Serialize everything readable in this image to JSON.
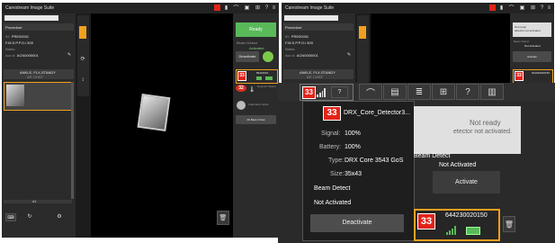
{
  "left": {
    "app_title": "Carestream Image Suite",
    "tab_label": "Procedure",
    "info_rows": [
      {
        "label": "ID:",
        "value": "PRE00001"
      },
      {
        "label": "",
        "value": "F.M.S.P.P.O.I 500"
      },
      {
        "label": "Notes",
        "value": ""
      },
      {
        "label": "Acc #:",
        "value": "ACN0000001"
      }
    ],
    "view_label": "ANKLE, FLX-STANDY",
    "view_sub": "AP, CHST",
    "ready_label": "Ready",
    "beam_detect": "Beam Detect",
    "beam_status": "Activated",
    "deactivate_label": "Deactivate",
    "detector_id": "89110510",
    "collapse_label": "Detector Status",
    "status_text": "Calibration Mode",
    "recon_label": "Alt Beam Ones",
    "zoom_value": "x1"
  },
  "right": {
    "app_title": "Carestream Image Suite",
    "tab_label": "Procedure",
    "info_rows": [
      {
        "label": "ID:",
        "value": "PRE00001"
      },
      {
        "label": "",
        "value": "F.M.S.P.P.O.I 500"
      },
      {
        "label": "Notes",
        "value": ""
      },
      {
        "label": "Acc #:",
        "value": "ACN0000001"
      }
    ],
    "view_label": "ANKLE, FLX-STANDY",
    "view_sub": "AP, CHST",
    "top_status": "Not ready\ndetector not activated",
    "beam_detect": "Beam Detect",
    "beam_status": "Not Activated",
    "activate_label": "Activate",
    "detector_id": "644230020150",
    "recon_label": "Alt Beam Ones"
  },
  "popup": {
    "badge": "33",
    "detector_name": "DRX_Core_Detector3...",
    "signal_label": "Signal:",
    "signal_value": "100%",
    "battery_label": "Battery:",
    "battery_value": "100%",
    "type_label": "Type:",
    "type_value": "DRX Core 3543 GoS",
    "size_label": "Size:",
    "size_value": "35x43",
    "beam_detect": "Beam Detect",
    "beam_status": "Not Activated",
    "deactivate_label": "Deactivate"
  },
  "overlay": {
    "not_ready_title": "Not ready",
    "not_ready_sub": "etector not activated.",
    "beam_detect": "Beam Detect",
    "beam_status": "Not Activated",
    "activate_label": "Activate",
    "detector_badge": "33",
    "detector_id": "644230020150",
    "toolbar_badge": "33"
  },
  "colors": {
    "accent_green": "#59b959",
    "badge_red": "#e2241a",
    "warning_orange": "#f0a020"
  }
}
